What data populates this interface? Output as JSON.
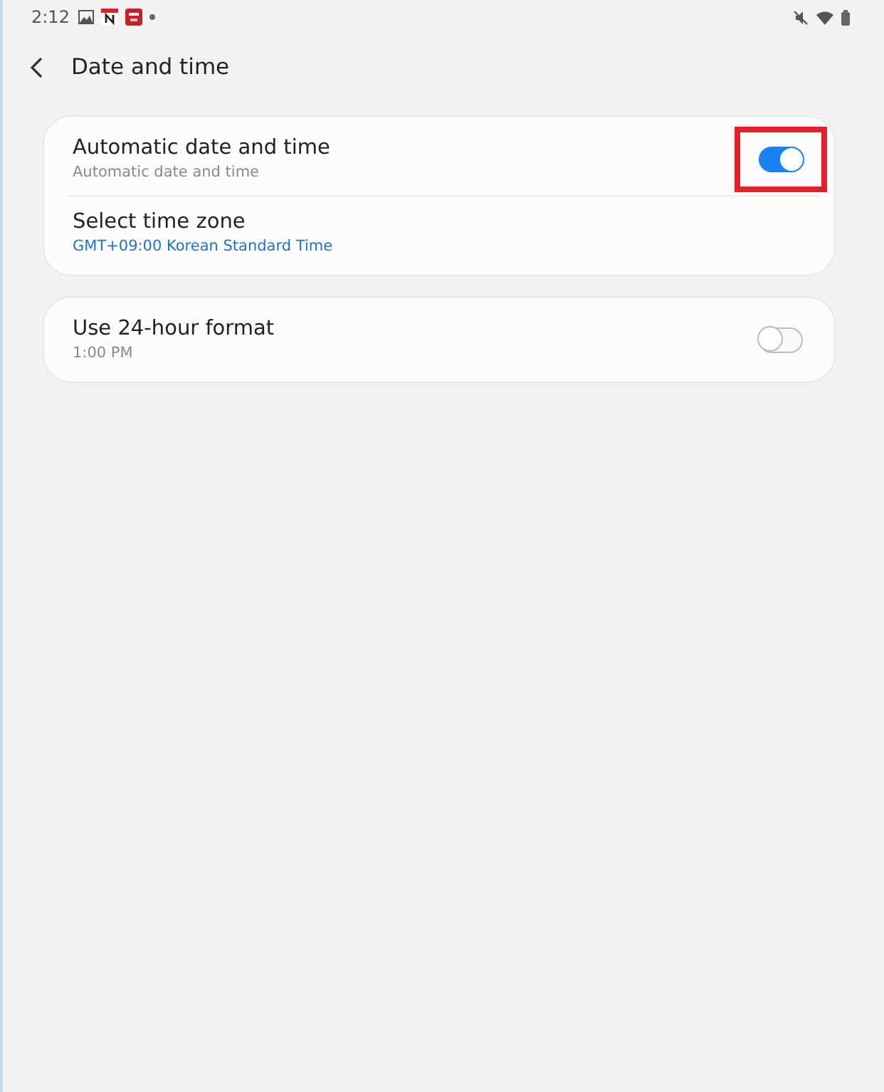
{
  "status_bar": {
    "time": "2:12"
  },
  "header": {
    "title": "Date and time"
  },
  "cards": [
    {
      "rows": [
        {
          "kind": "switch",
          "title": "Automatic date and time",
          "subtitle": "Automatic date and time",
          "on": true,
          "highlighted": true
        },
        {
          "kind": "picker",
          "title": "Select time zone",
          "subtitle": "GMT+09:00 Korean Standard Time"
        }
      ]
    },
    {
      "rows": [
        {
          "kind": "switch",
          "title": "Use 24-hour format",
          "subtitle": "1:00 PM",
          "on": false,
          "highlighted": false
        }
      ]
    }
  ]
}
